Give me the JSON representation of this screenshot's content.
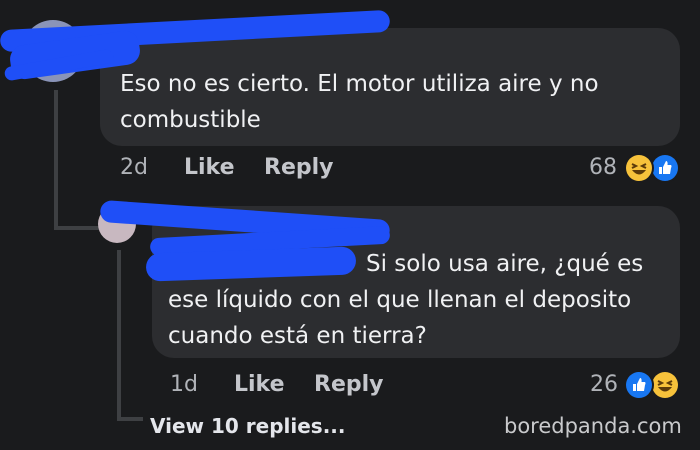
{
  "comment1": {
    "text_line1": "Eso no es cierto. El motor utiliza aire y no",
    "text_line2": "combustible",
    "time": "2d",
    "like_label": "Like",
    "reply_label": "Reply",
    "reaction_count": "68",
    "reactions": [
      "haha-icon",
      "like-icon"
    ]
  },
  "comment2": {
    "text_line1": "Si solo usa aire, ¿qué es",
    "text_line2": "ese líquido con el que llenan el deposito",
    "text_line3": "cuando está en tierra?",
    "time": "1d",
    "like_label": "Like",
    "reply_label": "Reply",
    "reaction_count": "26",
    "reactions": [
      "like-icon",
      "haha-icon"
    ]
  },
  "view_replies_label": "View 10 replies...",
  "watermark": "boredpanda.com",
  "colors": {
    "background": "#1a1b1d",
    "bubble": "#2c2d30",
    "redaction": "#1f4ff7",
    "like_blue": "#1877f2",
    "haha_yellow": "#f7c23b"
  }
}
